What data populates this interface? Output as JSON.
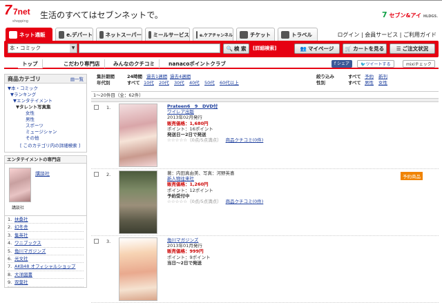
{
  "header": {
    "logo_text": "7net",
    "logo_sub": "shopping",
    "tagline": "生活のすべてはセブンネットで。",
    "brand": "セブン&アイ",
    "brand_sub": "HLDGS."
  },
  "tabs": [
    {
      "label": "ネット通販",
      "active": true
    },
    {
      "label": "e.デパート"
    },
    {
      "label": "ネットスーパー"
    },
    {
      "label": "ミールサービス"
    },
    {
      "label": "e.ケアチャンネル"
    },
    {
      "label": "チケット"
    },
    {
      "label": "トラベル"
    }
  ],
  "top_links": "ログイン | 会員サービス | ご利用ガイド",
  "search": {
    "category": "本・コミック",
    "placeholder": "",
    "button": "検 索",
    "advanced": "[詳細検索]",
    "mypage": "マイページ",
    "cart": "カートを見る",
    "order_status": "ご注文状況"
  },
  "subnav": [
    {
      "label": "トップ"
    },
    {
      "label": "こだわり専門店"
    },
    {
      "label": "みんなのクチコミ"
    },
    {
      "label": "nanacoポイントクラブ"
    }
  ],
  "share": {
    "facebook": "シェア",
    "twitter": "ツイートする",
    "mixi": "mixiチェック"
  },
  "sidebar": {
    "title": "商品カテゴリ",
    "list_link": "一覧",
    "tree": [
      {
        "label": "▼本・コミック"
      },
      {
        "label": "▼ランキング"
      },
      {
        "label": "▼エンタテイメント"
      },
      {
        "label": "▼タレント写真集",
        "bold": true
      },
      {
        "label": "女性"
      },
      {
        "label": "男性"
      },
      {
        "label": "スポーツ"
      },
      {
        "label": "ミュージシャン"
      },
      {
        "label": "その他"
      }
    ],
    "tree_footer": "[ このカテゴリ内の詳細検索 ]",
    "shop_title": "エンタテイメントの専門店",
    "featured_pub": "講談社",
    "featured_caption": "講談社",
    "publishers": [
      {
        "n": "1.",
        "label": "扶桑社"
      },
      {
        "n": "2.",
        "label": "幻冬舎"
      },
      {
        "n": "3.",
        "label": "集英社"
      },
      {
        "n": "4.",
        "label": "ワニブックス"
      },
      {
        "n": "5.",
        "label": "角川マガジンズ"
      },
      {
        "n": "6.",
        "label": "光文社"
      },
      {
        "n": "7.",
        "label": "AKB48 オフィシャルショップ"
      },
      {
        "n": "8.",
        "label": "大洋図書"
      },
      {
        "n": "9.",
        "label": "双葉社"
      }
    ]
  },
  "filters": {
    "period_label": "集計期間",
    "periods": [
      "24時間",
      "過去1週間",
      "過去4週間"
    ],
    "age_label": "年代別",
    "ages": [
      "すべて",
      "10代",
      "20代",
      "30代",
      "40代",
      "50代",
      "60代以上"
    ],
    "narrow_label": "絞り込み",
    "narrow_opts": [
      "すべて",
      "予約",
      "新刊"
    ],
    "gender_label": "性別",
    "genders": [
      "すべて",
      "男性",
      "女性"
    ]
  },
  "count_text": "1〜20件目（全：62件）",
  "items": [
    {
      "n": "1.",
      "title": "Prateen6　9　DVD付",
      "publisher": "ワイレア出版",
      "date": "2013年02月発行",
      "price_label": "販売価格：1,680円",
      "points": "ポイント：16ポイント",
      "note": "発送日ー2日で発送",
      "stars": "☆☆☆☆☆（0点/5点満点）",
      "review": "商品クチコミ(0件)",
      "preorder": "",
      "cover": "#e9c7c9"
    },
    {
      "n": "2.",
      "title": "",
      "credit": "著：内田真由美、写真：河野英喜",
      "publisher": "新人物往来社",
      "price_label": "販売価格：1,260円",
      "points": "ポイント：12ポイント",
      "note": "予約受付中",
      "stars": "☆☆☆☆☆（0点/5点満点）",
      "review": "商品クチコミ(0件)",
      "preorder": "予約商品",
      "cover": "#6b6a55"
    },
    {
      "n": "3.",
      "title": "",
      "publisher": "角川マガジンズ",
      "date": "2013年01月発行",
      "price_label": "販売価格：999円",
      "points": "ポイント：9ポイント",
      "note": "当日〜2日で発送",
      "stars": "",
      "review": "",
      "preorder": "",
      "cover": "#e7c4a8"
    }
  ]
}
